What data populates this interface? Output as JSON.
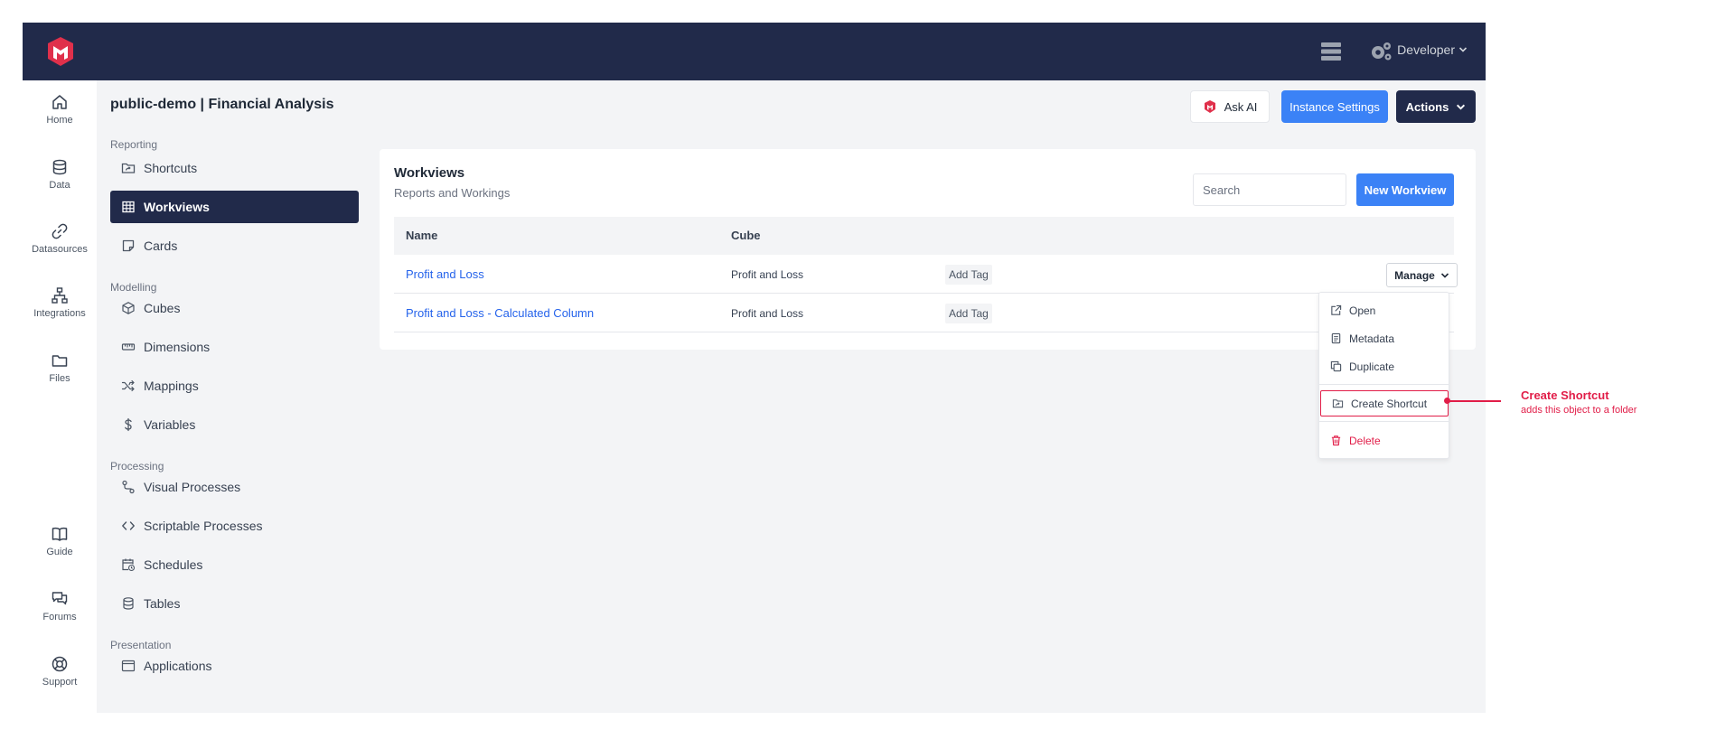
{
  "topbar": {
    "user_menu": "Developer",
    "icons": [
      "logo-icon",
      "server-icon",
      "settings-gears-icon",
      "chevron-down-icon"
    ]
  },
  "rail": {
    "items": [
      {
        "label": "Home",
        "icon": "home-icon"
      },
      {
        "label": "Data",
        "icon": "database-icon"
      },
      {
        "label": "Datasources",
        "icon": "link-icon"
      },
      {
        "label": "Integrations",
        "icon": "sitemap-icon"
      },
      {
        "label": "Files",
        "icon": "folder-icon"
      },
      {
        "label": "Guide",
        "icon": "book-icon"
      },
      {
        "label": "Forums",
        "icon": "chat-icon"
      },
      {
        "label": "Support",
        "icon": "lifebuoy-icon"
      }
    ]
  },
  "sidebar": {
    "project_title": "public-demo | Financial Analysis",
    "groups": [
      {
        "label": "Reporting",
        "items": [
          {
            "label": "Shortcuts",
            "icon": "folder-shortcut-icon"
          },
          {
            "label": "Workviews",
            "icon": "table-icon",
            "active": true
          },
          {
            "label": "Cards",
            "icon": "card-icon"
          }
        ]
      },
      {
        "label": "Modelling",
        "items": [
          {
            "label": "Cubes",
            "icon": "cube-icon"
          },
          {
            "label": "Dimensions",
            "icon": "ruler-icon"
          },
          {
            "label": "Mappings",
            "icon": "shuffle-icon"
          },
          {
            "label": "Variables",
            "icon": "dollar-icon"
          }
        ]
      },
      {
        "label": "Processing",
        "items": [
          {
            "label": "Visual Processes",
            "icon": "route-icon"
          },
          {
            "label": "Scriptable Processes",
            "icon": "code-icon"
          },
          {
            "label": "Schedules",
            "icon": "calendar-clock-icon"
          },
          {
            "label": "Tables",
            "icon": "database-icon"
          }
        ]
      },
      {
        "label": "Presentation",
        "items": [
          {
            "label": "Applications",
            "icon": "window-icon"
          }
        ]
      }
    ]
  },
  "header_actions": {
    "ask_ai": "Ask AI",
    "instance_settings": "Instance Settings",
    "actions": "Actions"
  },
  "workviews": {
    "title": "Workviews",
    "subtitle": "Reports and Workings",
    "search_placeholder": "Search",
    "new_button": "New Workview",
    "columns": [
      "Name",
      "Cube"
    ],
    "rows": [
      {
        "name": "Profit and Loss",
        "cube": "Profit and Loss",
        "tag": "Add Tag",
        "manage": "Manage"
      },
      {
        "name": "Profit and Loss - Calculated Column",
        "cube": "Profit and Loss",
        "tag": "Add Tag"
      }
    ]
  },
  "manage_menu": {
    "items": [
      {
        "label": "Open",
        "icon": "external-link-icon"
      },
      {
        "label": "Metadata",
        "icon": "document-icon"
      },
      {
        "label": "Duplicate",
        "icon": "copy-icon"
      },
      {
        "label": "Create Shortcut",
        "icon": "folder-shortcut-icon",
        "highlighted": true
      },
      {
        "label": "Delete",
        "icon": "trash-icon",
        "danger": true
      }
    ]
  },
  "callout": {
    "title": "Create Shortcut",
    "subtitle": "adds this object to a folder"
  },
  "colors": {
    "navy": "#212a4a",
    "primary_blue": "#3b82f6",
    "link_blue": "#2563eb",
    "accent_red": "#e11d48",
    "background": "#f3f4f6"
  }
}
